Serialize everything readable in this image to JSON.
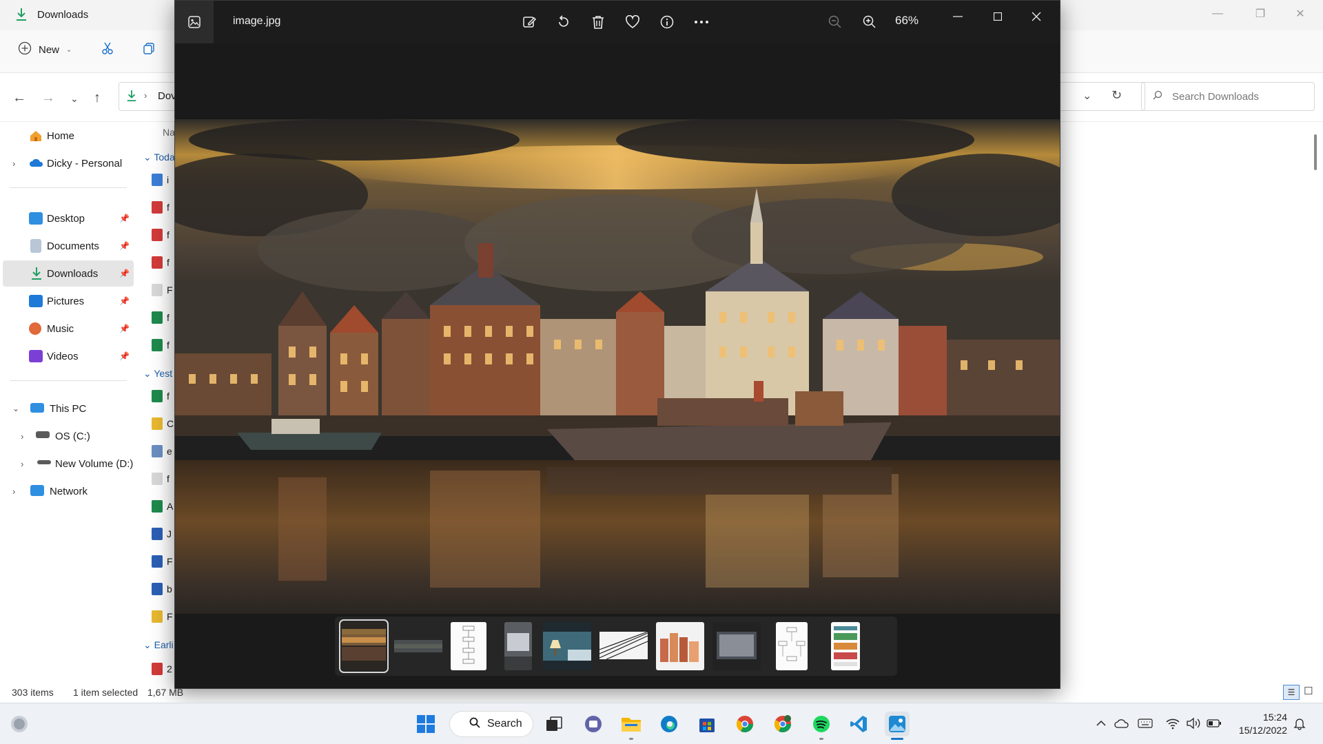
{
  "explorer": {
    "title": "Downloads",
    "toolbar": {
      "new_label": "New"
    },
    "address": {
      "path_partial": "Dov",
      "search_placeholder": "Search Downloads"
    },
    "sidebar": {
      "home": "Home",
      "onedrive": "Dicky - Personal",
      "desktop": "Desktop",
      "documents": "Documents",
      "downloads": "Downloads",
      "pictures": "Pictures",
      "music": "Music",
      "videos": "Videos",
      "this_pc": "This PC",
      "os_c": "OS (C:)",
      "new_volume": "New Volume (D:)",
      "network": "Network"
    },
    "filelist": {
      "name_header": "Na",
      "group_today": "Toda",
      "group_yesterday": "Yest",
      "group_earlier": "Earli",
      "rows": [
        "i",
        "f",
        "f",
        "f",
        "F",
        "f",
        "f",
        "f",
        "C",
        "e",
        "f",
        "A",
        "J",
        "F",
        "b",
        "F",
        "2"
      ]
    },
    "status": {
      "items": "303 items",
      "selected": "1 item selected",
      "size": "1,67 MB"
    }
  },
  "viewer": {
    "filename": "image.jpg",
    "zoom": "66%",
    "tools": [
      "edit-icon",
      "rotate-icon",
      "delete-icon",
      "favorite-icon",
      "info-icon",
      "more-icon"
    ],
    "thumbnails": [
      "harbor-night",
      "harbor-wide",
      "flowchart-doc",
      "screen-photo",
      "bedroom-lamp",
      "building-facade",
      "city-buildings",
      "monitor-photo",
      "diagram-doc",
      "colorful-doc"
    ]
  },
  "taskbar": {
    "search_label": "Search",
    "time": "15:24",
    "date": "15/12/2022"
  },
  "colors": {
    "accent": "#1a73c7",
    "viewer_bg": "#1f1f1f",
    "taskbar_bg": "#eef1f5"
  }
}
